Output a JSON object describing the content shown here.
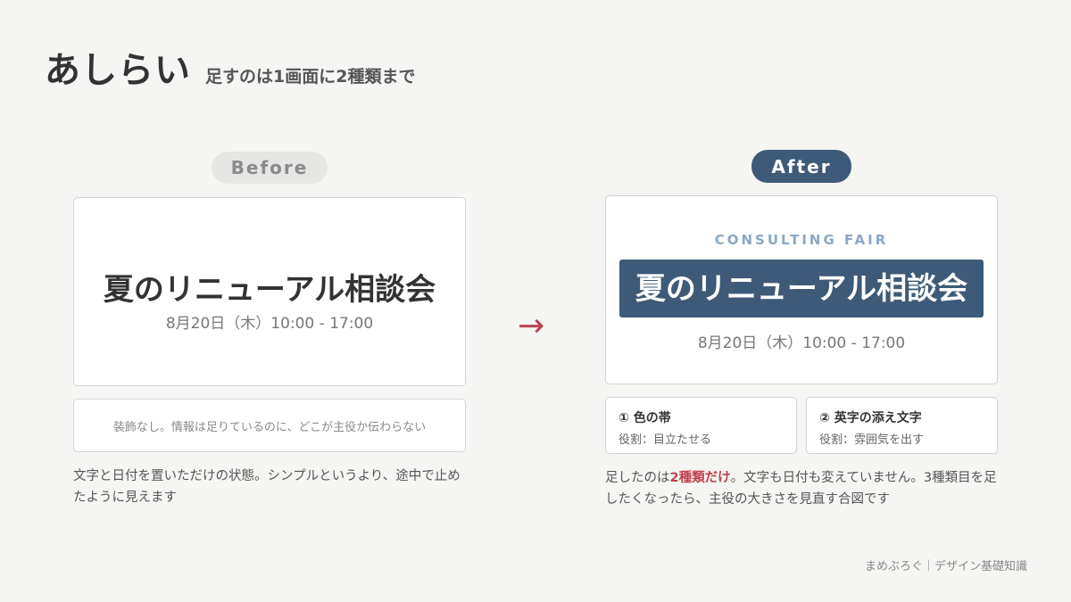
{
  "header": {
    "title": "あしらい",
    "subtitle": "足すのは1画面に2種類まで"
  },
  "before": {
    "label": "Before",
    "card_title": "夏のリニューアル相談会",
    "card_date": "8月20日（木）10:00 - 17:00",
    "note": "装飾なし。情報は足りているのに、どこが主役か伝わらない",
    "caption": "文字と日付を置いただけの状態。シンプルというより、途中で止めたように見えます"
  },
  "arrow": "→",
  "after": {
    "label": "After",
    "eyebrow": "CONSULTING FAIR",
    "card_title": "夏のリニューアル相談会",
    "card_date": "8月20日（木）10:00 - 17:00",
    "roles": [
      {
        "title": "① 色の帯",
        "desc": "役割：目立たせる"
      },
      {
        "title": "② 英字の添え文字",
        "desc": "役割：雰囲気を出す"
      }
    ],
    "caption_pre": "足したのは",
    "caption_highlight": "2種類だけ",
    "caption_post": "。文字も日付も変えていません。3種類目を足したくなったら、主役の大きさを見直す合図です"
  },
  "footer": "まめぶろぐ｜デザイン基礎知識",
  "colors": {
    "background": "#f5f5f3",
    "accent_navy": "#3d5a78",
    "eyebrow_blue": "#8ca7c6",
    "highlight_red": "#c0404d"
  }
}
